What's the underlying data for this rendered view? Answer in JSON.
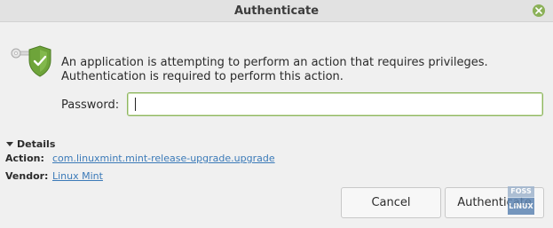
{
  "window": {
    "title": "Authenticate"
  },
  "message": "An application is attempting to perform an action that requires privileges. Authentication is required to perform this action.",
  "password": {
    "label": "Password:",
    "value": ""
  },
  "details": {
    "toggle_label": "Details",
    "action_label": "Action:",
    "action_value": "com.linuxmint.mint-release-upgrade.upgrade",
    "vendor_label": "Vendor:",
    "vendor_value": "Linux Mint"
  },
  "buttons": {
    "cancel": "Cancel",
    "authenticate": "Authenticate"
  },
  "watermark": {
    "top": "FOSS",
    "bottom": "LINUX"
  },
  "colors": {
    "accent": "#8bb158",
    "link": "#3b7ab8",
    "shield": "#6ea43a"
  },
  "icons": {
    "close": "close-icon",
    "auth": "key-shield-icon",
    "expander": "triangle-down-icon"
  }
}
